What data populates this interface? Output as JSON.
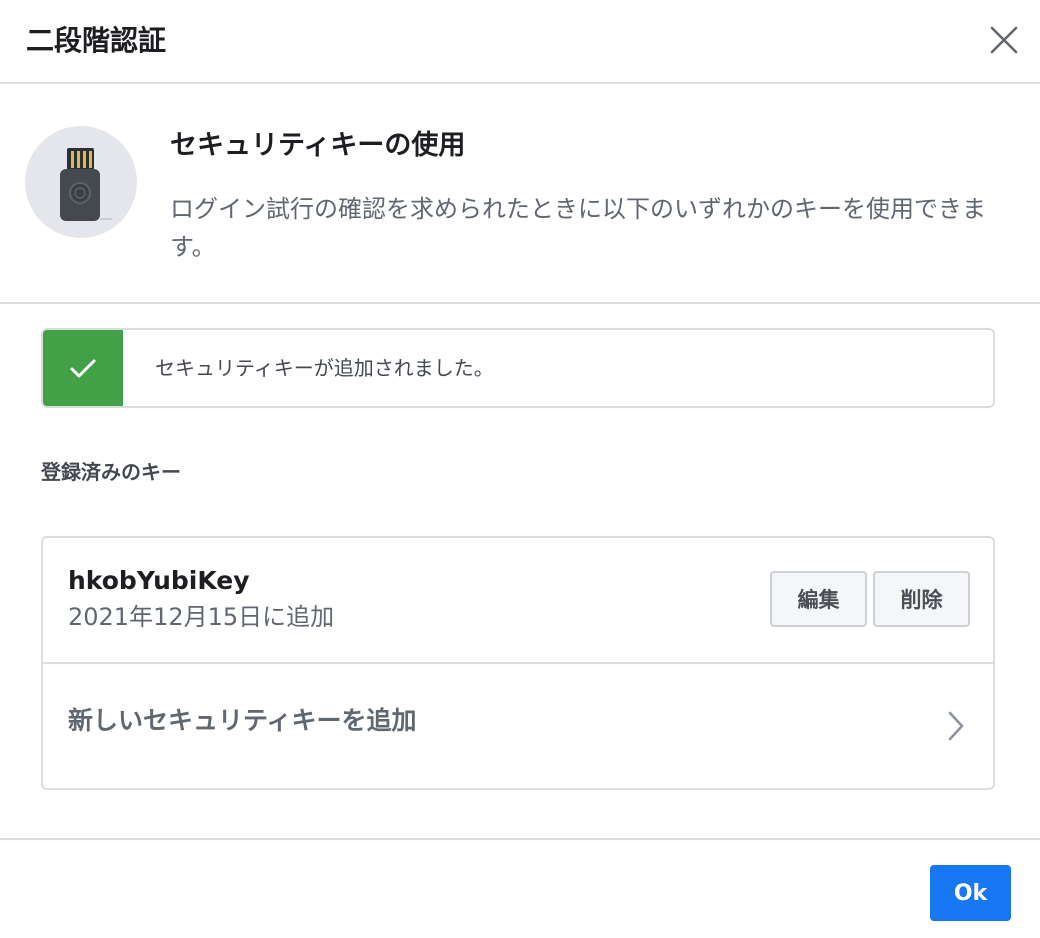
{
  "dialog": {
    "title": "二段階認証",
    "close_icon": "close-icon"
  },
  "intro": {
    "illustration_icon": "security-key-icon",
    "title": "セキュリティキーの使用",
    "description": "ログイン試行の確認を求められたときに以下のいずれかのキーを使用できます。"
  },
  "success_banner": {
    "icon": "checkmark-icon",
    "message": "セキュリティキーが追加されました。",
    "color": "#42a147"
  },
  "registered_keys": {
    "label": "登録済みのキー",
    "keys": [
      {
        "name": "hkobYubiKey",
        "added": "2021年12月15日に追加",
        "edit_label": "編集",
        "delete_label": "削除"
      }
    ],
    "add_label": "新しいセキュリティキーを追加",
    "add_icon": "chevron-right-icon"
  },
  "footer": {
    "ok_label": "Ok",
    "ok_color": "#1877f2"
  }
}
